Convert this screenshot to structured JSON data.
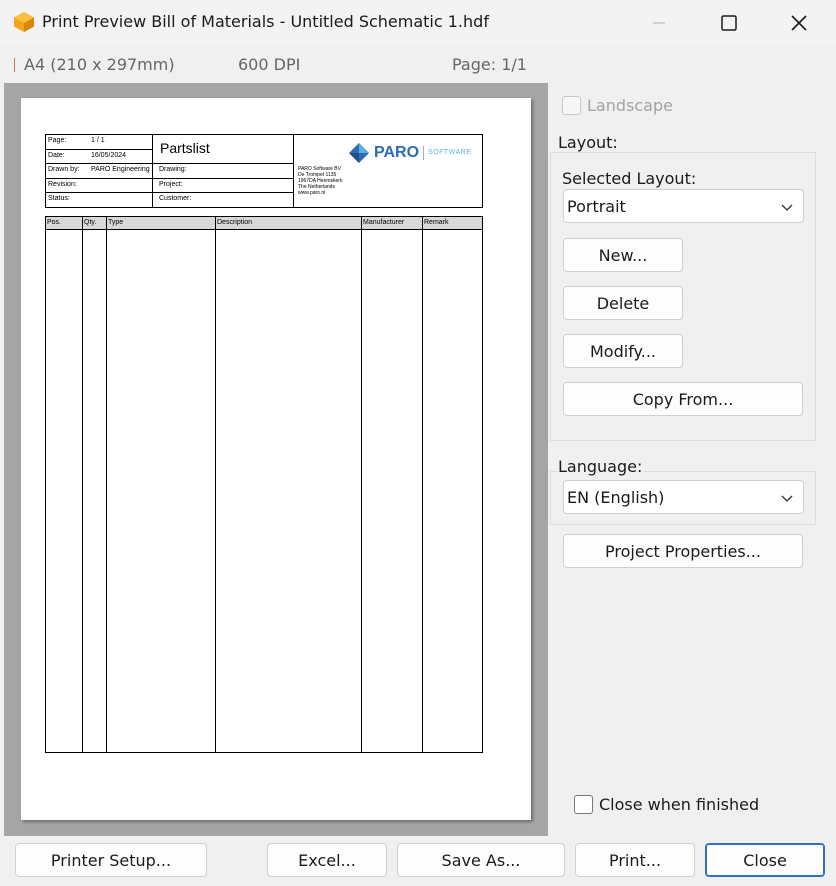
{
  "window": {
    "title": "Print Preview Bill of Materials - Untitled Schematic 1.hdf"
  },
  "infobar": {
    "paper": "A4 (210 x 297mm)",
    "dpi": "600 DPI",
    "page": "Page: 1/1"
  },
  "titleblock": {
    "page_label": "Page:",
    "page_value": "1   / 1",
    "date_label": "Date:",
    "date_value": "16/05/2024",
    "drawnby_label": "Drawn by:",
    "drawnby_value": "PARO Engineering",
    "revision_label": "Revision:",
    "status_label": "Status:",
    "title": "Partslist",
    "drawing_label": "Drawing:",
    "project_label": "Project:",
    "customer_label": "Customer:",
    "logo_text": "PARO",
    "logo_sub": "SOFTWARE",
    "address": [
      "PARO Software BV",
      "De Trompet 1135",
      "1967DA Heemskerk",
      "The Netherlands",
      "www.paro.nl"
    ]
  },
  "parts_table": {
    "columns": [
      "Pos.",
      "Qty.",
      "Type",
      "Description",
      "Manufacturer",
      "Remark"
    ]
  },
  "options": {
    "landscape_label": "Landscape",
    "landscape_checked": false,
    "layout_group_label": "Layout:",
    "selected_layout_label": "Selected Layout:",
    "selected_layout_value": "Portrait",
    "new_button": "New...",
    "delete_button": "Delete",
    "modify_button": "Modify...",
    "copy_from_button": "Copy From...",
    "language_label": "Language:",
    "language_value": "EN (English)",
    "project_properties_button": "Project Properties...",
    "close_when_finished_label": "Close when finished",
    "close_when_finished_checked": false
  },
  "footer": {
    "printer_setup": "Printer Setup...",
    "excel": "Excel...",
    "save_as": "Save As...",
    "print": "Print...",
    "close": "Close"
  },
  "colors": {
    "logo_blue": "#2a6db5",
    "logo_light": "#5ab0e0",
    "app_icon_orange": "#f2a51c",
    "primary_border": "#2f6fc0"
  }
}
